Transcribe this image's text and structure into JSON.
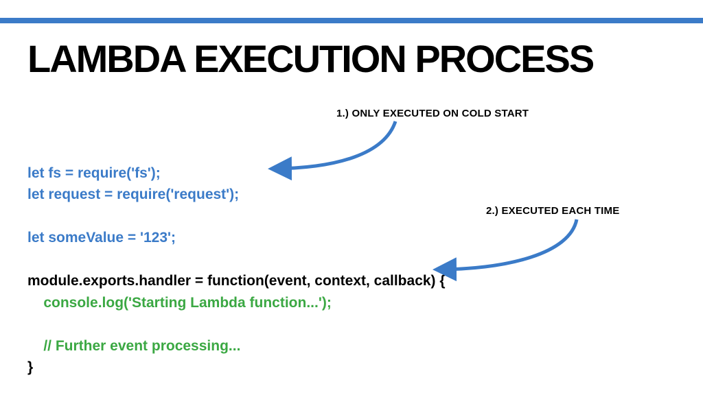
{
  "title": "LAMBDA EXECUTION PROCESS",
  "code": {
    "line1": "let fs = require('fs');",
    "line2": "let request = require('request');",
    "line4": "let someValue = '123';",
    "line6": "module.exports.handler = function(event, context, callback) {",
    "line7": "    console.log('Starting Lambda function...');",
    "line9": "    // Further event processing...",
    "line10": "}"
  },
  "annotations": {
    "a1": "1.) ONLY EXECUTED ON COLD START",
    "a2": "2.) EXECUTED EACH TIME"
  },
  "colors": {
    "accent": "#3b7bc8",
    "code_blue": "#3b7bc8",
    "code_green": "#3ba843"
  }
}
